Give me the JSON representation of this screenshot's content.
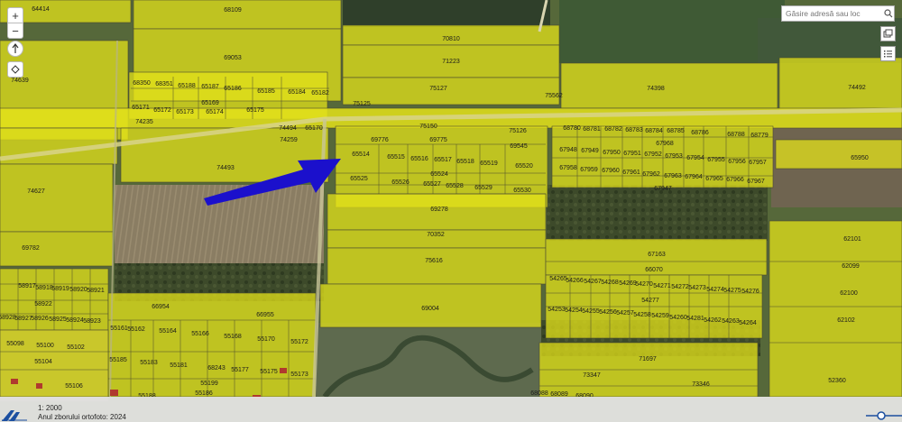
{
  "map": {
    "arrow_color": "#1b10cc",
    "parcel_fill": "#e3e21a",
    "parcels": [
      "64414",
      "68109",
      "69053",
      "70810",
      "71223",
      "75127",
      "75562",
      "74398",
      "74492",
      "74639",
      "68350",
      "68351",
      "65188",
      "65187",
      "65186",
      "65185",
      "65184",
      "65182",
      "65171",
      "65172",
      "65173",
      "65169",
      "65174",
      "65175",
      "74235",
      "75125",
      "74494",
      "65170",
      "74259",
      "75150",
      "75126",
      "68780",
      "68781",
      "68782",
      "68783",
      "68784",
      "68785",
      "68786",
      "68788",
      "68779",
      "69776",
      "69775",
      "69545",
      "67968",
      "67948",
      "67949",
      "67950",
      "67951",
      "67952",
      "67953",
      "67954",
      "67955",
      "67956",
      "67957",
      "65950",
      "74493",
      "65514",
      "65515",
      "65516",
      "65517",
      "65518",
      "65519",
      "65520",
      "67958",
      "67959",
      "67960",
      "67961",
      "67962",
      "67963",
      "67964",
      "67965",
      "67966",
      "67967",
      "65524",
      "65525",
      "65526",
      "65527",
      "65528",
      "65529",
      "65530",
      "67947",
      "74627",
      "69278",
      "70352",
      "75616",
      "62101",
      "69782",
      "67163",
      "62099",
      "66070",
      "58917",
      "58918",
      "58919",
      "58920",
      "58921",
      "54265",
      "54266",
      "54267",
      "54268",
      "54269",
      "54270",
      "54271",
      "54272",
      "54273",
      "54274",
      "54275",
      "54276",
      "62100",
      "58922",
      "54277",
      "66954",
      "69004",
      "68928",
      "58927",
      "58926",
      "58925",
      "58924",
      "58923",
      "66955",
      "54253",
      "54254",
      "54255",
      "54256",
      "54257",
      "54258",
      "54259",
      "54260",
      "54281",
      "54262",
      "54263",
      "54264",
      "62102",
      "55161",
      "55162",
      "55164",
      "55166",
      "55168",
      "55170",
      "55172",
      "55098",
      "55100",
      "55102",
      "71697",
      "55104",
      "55185",
      "55183",
      "55181",
      "68243",
      "55177",
      "55175",
      "55173",
      "73347",
      "73346",
      "52360",
      "55106",
      "55188",
      "55199",
      "55186",
      "68088",
      "68089",
      "68090"
    ]
  },
  "controls": {
    "zoom_in": "+",
    "zoom_out": "−"
  },
  "search": {
    "placeholder": "Găsire adresă sau loc"
  },
  "footer": {
    "scale": "1: 2000",
    "year": "Anul zborului ortofoto: 2024"
  }
}
